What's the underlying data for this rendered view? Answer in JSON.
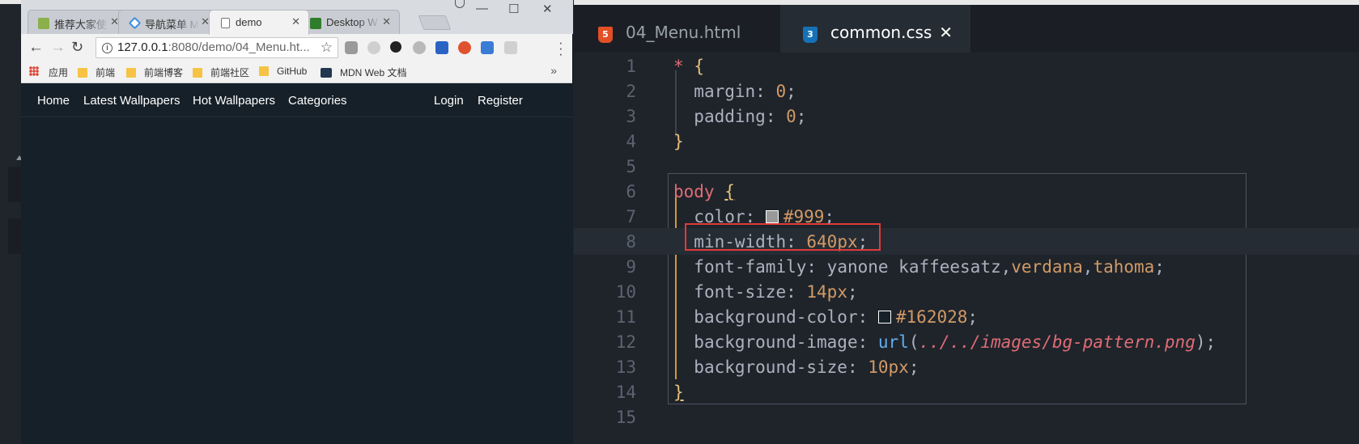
{
  "browser": {
    "tabs": [
      {
        "title": "推荐大家使",
        "favicon_color": "#8bb04a"
      },
      {
        "title": "导航菜单 M",
        "favicon_color": "#3b8de0"
      },
      {
        "title": "demo",
        "favicon_color": "#ffffff"
      },
      {
        "title": "Desktop W",
        "favicon_color": "#2f7d2a"
      }
    ],
    "address": {
      "host": "127.0.0.1",
      "path": ":8080/demo/04_Menu.ht..."
    },
    "bookmarks": [
      "应用",
      "前端",
      "前端博客",
      "前端社区",
      "GitHub",
      "MDN Web 文档"
    ],
    "site_nav": {
      "left": [
        "Home",
        "Latest Wallpapers",
        "Hot Wallpapers",
        "Categories"
      ],
      "right": [
        "Login",
        "Register"
      ]
    }
  },
  "editor": {
    "tabs": [
      {
        "badge": "5",
        "label": "04_Menu.html"
      },
      {
        "badge": "3",
        "label": "common.css"
      }
    ],
    "close_glyph": "✕",
    "line_numbers": [
      "1",
      "2",
      "3",
      "4",
      "5",
      "6",
      "7",
      "8",
      "9",
      "10",
      "11",
      "12",
      "13",
      "14",
      "15"
    ],
    "code": {
      "l1_sel": "*",
      "l1_brace": "{",
      "l2_prop": "margin",
      "l2_val": "0",
      "l3_prop": "padding",
      "l3_val": "0",
      "l4_brace": "}",
      "l6_sel": "body",
      "l6_brace": "{",
      "l7_prop": "color",
      "l7_val": "#999",
      "l7_swatch": "#999999",
      "l8_prop": "min-width",
      "l8_val": "640px",
      "l9_prop": "font-family",
      "l9_v1": "yanone kaffeesatz",
      "l9_v2": "verdana",
      "l9_v3": "tahoma",
      "l10_prop": "font-size",
      "l10_val": "14px",
      "l11_prop": "background-color",
      "l11_val": "#162028",
      "l11_swatch": "#162028",
      "l12_prop": "background-image",
      "l12_fn": "url",
      "l12_str": "../../images/bg-pattern.png",
      "l13_prop": "background-size",
      "l13_val": "10px",
      "l14_brace": "}"
    }
  }
}
